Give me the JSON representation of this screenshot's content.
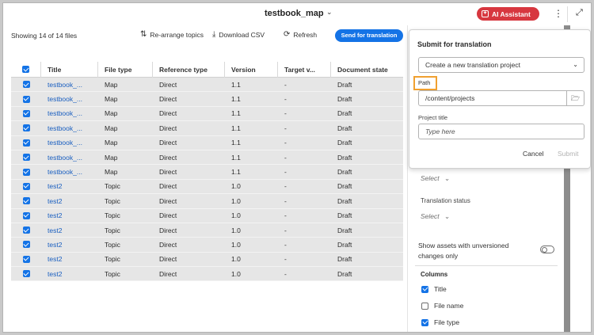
{
  "header": {
    "doc_title": "testbook_map",
    "ai_assistant_label": "AI Assistant"
  },
  "toolbar": {
    "showing": "Showing 14 of 14 files",
    "rearrange": "Re-arrange topics",
    "download": "Download CSV",
    "refresh": "Refresh",
    "send": "Send for translation"
  },
  "table": {
    "headers": [
      "Title",
      "File type",
      "Reference type",
      "Version",
      "Target v...",
      "Document state"
    ],
    "rows": [
      [
        "testbook_...",
        "Map",
        "Direct",
        "1.1",
        "-",
        "Draft"
      ],
      [
        "testbook_...",
        "Map",
        "Direct",
        "1.1",
        "-",
        "Draft"
      ],
      [
        "testbook_...",
        "Map",
        "Direct",
        "1.1",
        "-",
        "Draft"
      ],
      [
        "testbook_...",
        "Map",
        "Direct",
        "1.1",
        "-",
        "Draft"
      ],
      [
        "testbook_...",
        "Map",
        "Direct",
        "1.1",
        "-",
        "Draft"
      ],
      [
        "testbook_...",
        "Map",
        "Direct",
        "1.1",
        "-",
        "Draft"
      ],
      [
        "testbook_...",
        "Map",
        "Direct",
        "1.1",
        "-",
        "Draft"
      ],
      [
        "test2",
        "Topic",
        "Direct",
        "1.0",
        "-",
        "Draft"
      ],
      [
        "test2",
        "Topic",
        "Direct",
        "1.0",
        "-",
        "Draft"
      ],
      [
        "test2",
        "Topic",
        "Direct",
        "1.0",
        "-",
        "Draft"
      ],
      [
        "test2",
        "Topic",
        "Direct",
        "1.0",
        "-",
        "Draft"
      ],
      [
        "test2",
        "Topic",
        "Direct",
        "1.0",
        "-",
        "Draft"
      ],
      [
        "test2",
        "Topic",
        "Direct",
        "1.0",
        "-",
        "Draft"
      ],
      [
        "test2",
        "Topic",
        "Direct",
        "1.0",
        "-",
        "Draft"
      ]
    ]
  },
  "side_panel": {
    "select_placeholder_1": "Select",
    "translation_status_label": "Translation status",
    "select_placeholder_2": "Select",
    "unversioned_text_line1": "Show assets with unversioned",
    "unversioned_text_line2": "changes only",
    "columns_label": "Columns",
    "columns": [
      {
        "label": "Title",
        "checked": true
      },
      {
        "label": "File name",
        "checked": false
      },
      {
        "label": "File type",
        "checked": true
      }
    ]
  },
  "popover": {
    "title": "Submit for translation",
    "project_select_value": "Create a new translation project",
    "path_label": "Path",
    "path_value": "/content/projects",
    "project_title_label": "Project title",
    "project_title_placeholder": "Type here",
    "cancel": "Cancel",
    "submit": "Submit"
  },
  "colors": {
    "accent_blue": "#1473e6",
    "ai_red": "#d7373f",
    "highlight_orange": "#f0a030",
    "row_bg": "#e6e6e6"
  }
}
